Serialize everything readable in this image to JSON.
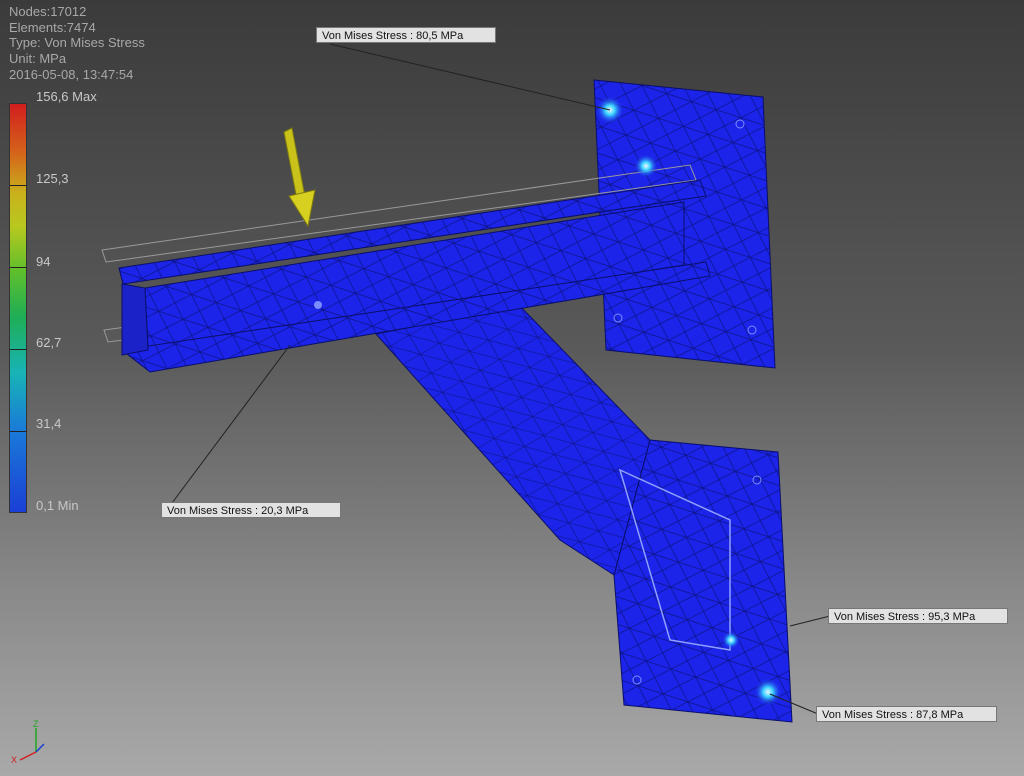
{
  "info": {
    "nodes": "Nodes:17012",
    "elements": "Elements:7474",
    "type": "Type: Von Mises Stress",
    "unit": "Unit: MPa",
    "timestamp": "2016-05-08, 13:47:54"
  },
  "legend": {
    "max_label": "156,6 Max",
    "ticks": [
      "125,3",
      "94",
      "62,7",
      "31,4"
    ],
    "min_label": "0,1 Min",
    "max_value": 156.6,
    "min_value": 0.1,
    "colors": [
      "#d21e1e",
      "#d4641a",
      "#c9b21c",
      "#5fbf2c",
      "#1fae55",
      "#18b3b6",
      "#1a7ad8",
      "#1a3fd6"
    ]
  },
  "probes": [
    {
      "label": "Von Mises Stress : 80,5 MPa"
    },
    {
      "label": "Von Mises Stress : 20,3 MPa"
    },
    {
      "label": "Von Mises Stress : 95,3 MPa"
    },
    {
      "label": "Von Mises Stress : 87,8 MPa"
    }
  ],
  "model": {
    "mesh_color": "#1b24e8",
    "load_arrow_color": "#c8c21a"
  },
  "triad": {
    "axis_z": "Z",
    "axis_x": "X"
  }
}
